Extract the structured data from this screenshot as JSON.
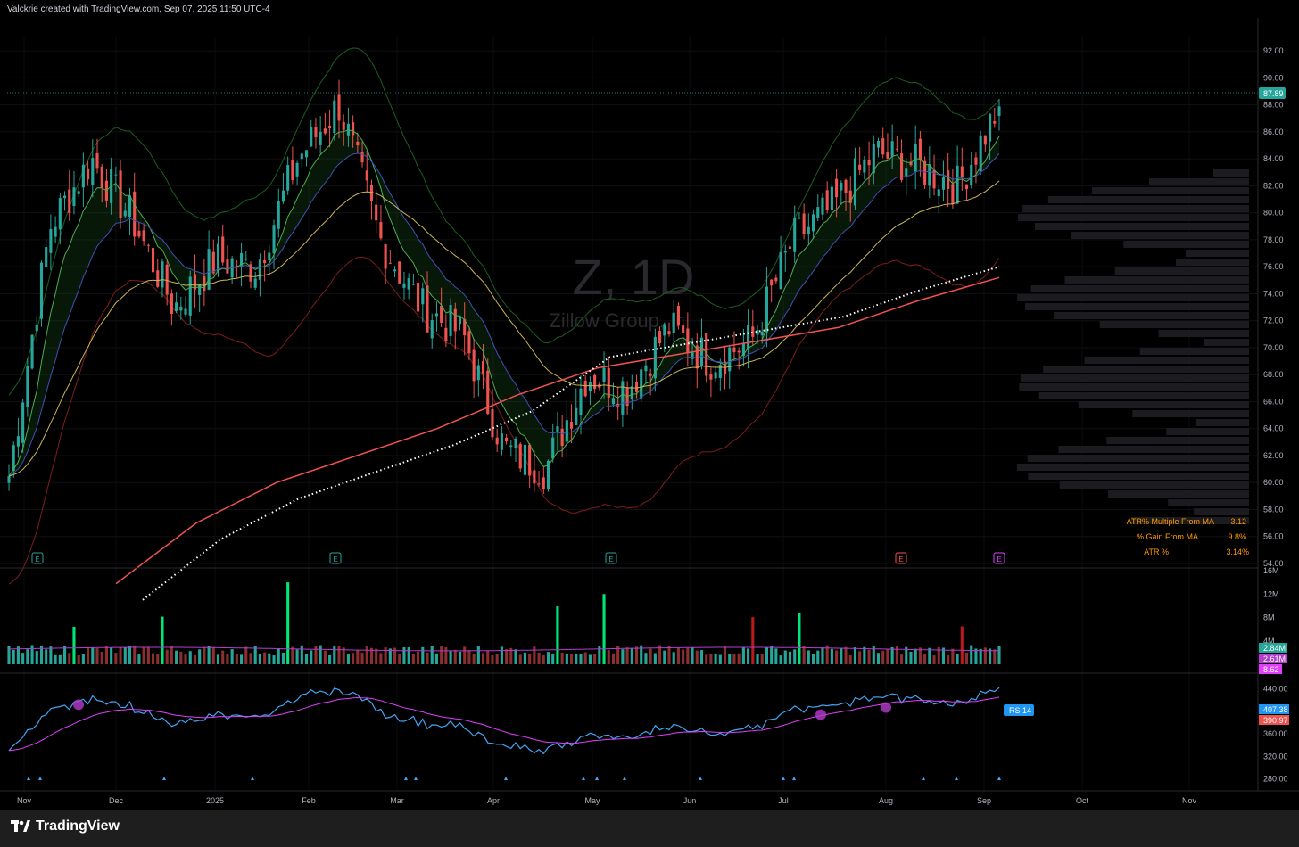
{
  "header": {
    "title": "Valckrie created with TradingView.com, Sep 07, 2025 11:50 UTC-4"
  },
  "watermark": {
    "symbol": "Z, 1D",
    "name": "Zillow Group, Ir"
  },
  "footer": {
    "brand": "TradingView"
  },
  "colors": {
    "up": "#26a69a",
    "down": "#ef5350",
    "sma200": "#f05350",
    "ema": "#c9b458",
    "rs": "#42a5f5",
    "rs_ma": "#e040fb"
  },
  "price_axis": {
    "ticks": [
      "92.00",
      "90.00",
      "88.00",
      "86.00",
      "84.00",
      "82.00",
      "80.00",
      "78.00",
      "76.00",
      "74.00",
      "72.00",
      "70.00",
      "68.00",
      "66.00",
      "64.00",
      "62.00",
      "60.00",
      "58.00",
      "56.00",
      "54.00"
    ],
    "last_label": "87.89"
  },
  "volume_axis": {
    "ticks": [
      "16M",
      "12M",
      "8M",
      "4M"
    ],
    "labels": [
      "2.84M",
      "2.61M",
      "8.62"
    ]
  },
  "rs_axis": {
    "ticks": [
      "440.00",
      "360.00",
      "320.00",
      "280.00"
    ],
    "labels": [
      "407.38",
      "390.97"
    ],
    "badge": "RS 14"
  },
  "time_axis": {
    "labels": [
      "Nov",
      "Dec",
      "2025",
      "Feb",
      "Mar",
      "Apr",
      "May",
      "Jun",
      "Jul",
      "Aug",
      "Sep",
      "Oct",
      "Nov"
    ]
  },
  "stats": [
    {
      "label": "ATR% Multiple From MA",
      "value": "3.12"
    },
    {
      "label": "% Gain From MA",
      "value": "9.8%"
    },
    {
      "label": "ATR %",
      "value": "3.14%"
    }
  ],
  "event_markers": [
    "E",
    "E",
    "E",
    "E",
    "E"
  ],
  "chart_data": {
    "type": "candlestick",
    "title": "Z, 1D",
    "subtitle": "Zillow Group, Ir",
    "ylim": [
      54,
      93
    ],
    "x": [
      "Nov",
      "Dec",
      "2025",
      "Feb",
      "Mar",
      "Apr",
      "May",
      "Jun",
      "Jul",
      "Aug",
      "Sep"
    ],
    "close": [
      60.5,
      79.0,
      84.0,
      79.5,
      73.0,
      76.5,
      76.0,
      84.0,
      88.0,
      78.0,
      73.0,
      71.0,
      62.5,
      61.0,
      68.0,
      67.0,
      71.5,
      69.0,
      70.5,
      78.0,
      80.5,
      84.5,
      83.5,
      82.0,
      87.89
    ],
    "sma200": [
      52.5,
      57.0,
      60.0,
      62.0,
      64.0,
      66.5,
      68.5,
      69.5,
      70.5,
      71.5,
      73.5,
      75.2
    ],
    "last_price": 87.89
  }
}
